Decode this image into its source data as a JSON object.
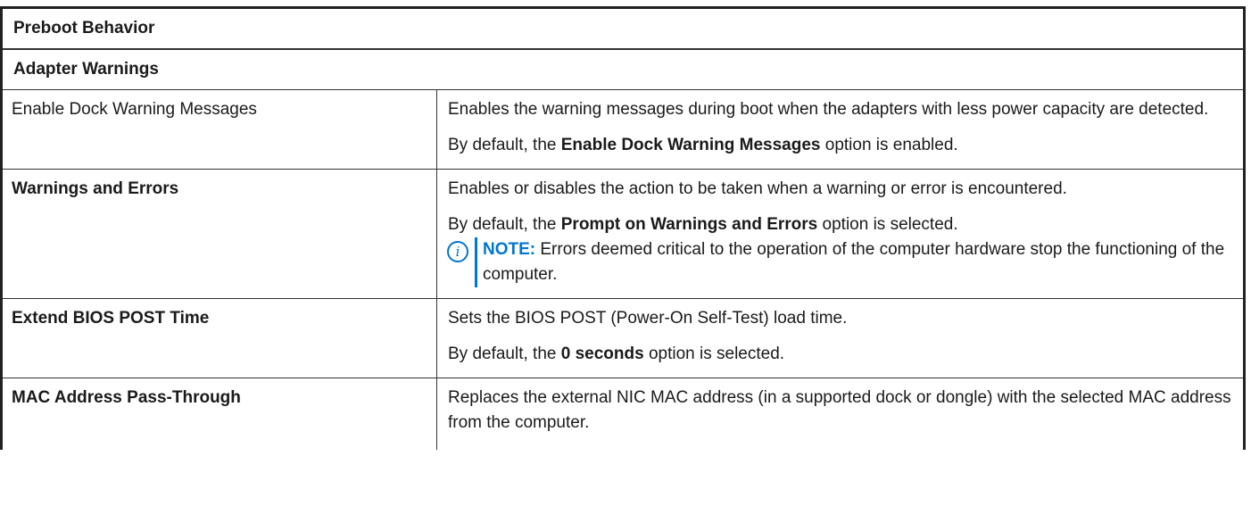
{
  "table": {
    "title": "Preboot Behavior",
    "section": "Adapter Warnings",
    "rows": [
      {
        "name": "Enable Dock Warning Messages",
        "desc1": "Enables the warning messages during boot when the adapters with less power capacity are detected.",
        "default_prefix": "By default, the ",
        "default_bold": "Enable Dock Warning Messages",
        "default_suffix": " option is enabled."
      },
      {
        "name": "Warnings and Errors",
        "desc1": "Enables or disables the action to be taken when a warning or error is encountered.",
        "default_prefix": "By default, the ",
        "default_bold": "Prompt on Warnings and Errors",
        "default_suffix": " option is selected.",
        "note_label": "NOTE:",
        "note_text": " Errors deemed critical to the operation of the computer hardware stop the functioning of the computer.",
        "note_icon": "info-icon"
      },
      {
        "name": "Extend BIOS POST Time",
        "desc1": "Sets the BIOS POST (Power-On Self-Test) load time.",
        "default_prefix": "By default, the ",
        "default_bold": "0 seconds",
        "default_suffix": " option is selected."
      },
      {
        "name": "MAC Address Pass-Through",
        "desc1": "Replaces the external NIC MAC address (in a supported dock or dongle) with the selected MAC address from the computer."
      }
    ]
  },
  "colors": {
    "note_accent": "#0076ce",
    "border": "#333333"
  }
}
